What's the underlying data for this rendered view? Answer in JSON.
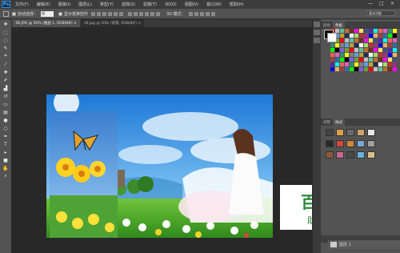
{
  "app": {
    "logo": "Ps",
    "brand_color": "#31a8ff"
  },
  "menu": {
    "items": [
      "文件(F)",
      "编辑(E)",
      "图像(I)",
      "图层(L)",
      "类型(Y)",
      "选择(S)",
      "滤镜(T)",
      "3D(D)",
      "视图(V)",
      "窗口(W)",
      "帮助(H)"
    ]
  },
  "window_controls": {
    "minimize": "—",
    "maximize": "□",
    "close": "×"
  },
  "options": {
    "auto_select_label": "自动选择：",
    "auto_select_value": "组",
    "show_transform_label": "显示变换控件",
    "mode_3d_label": "3D 模式：",
    "workspace": "基本功能"
  },
  "tabs": [
    {
      "label": "3D.JPG @ 50% (图层 1, RGB/8#) ×"
    },
    {
      "label": "19.jpg @ 50% (背景, RGB/8#) ×"
    }
  ],
  "panels": {
    "top_tabs": [
      "颜色",
      "色板"
    ],
    "mid_tabs": [
      "调整",
      "样式"
    ],
    "layer_name": "图层 1"
  },
  "watermark": {
    "title": "百科全说",
    "subtitle": "助你轻松解决",
    "color": "#2f8a3e"
  },
  "tools": [
    "move-icon",
    "marquee-icon",
    "lasso-icon",
    "quick-select-icon",
    "crop-icon",
    "eyedropper-icon",
    "healing-icon",
    "brush-icon",
    "stamp-icon",
    "history-brush-icon",
    "eraser-icon",
    "gradient-icon",
    "blur-icon",
    "dodge-icon",
    "pen-icon",
    "type-icon",
    "path-select-icon",
    "shape-icon",
    "hand-icon",
    "zoom-icon"
  ]
}
